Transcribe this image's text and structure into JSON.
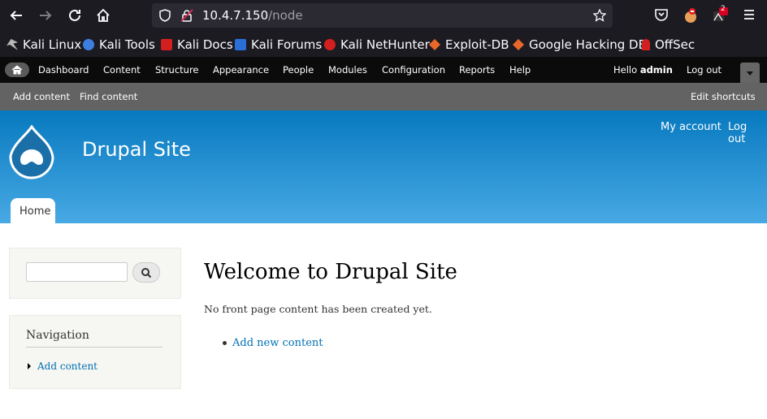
{
  "browser": {
    "url_host": "10.4.7.150",
    "url_path": "/node",
    "notification_count": "2"
  },
  "bookmarks": [
    {
      "label": "Kali Linux",
      "color": "#b8b8b8"
    },
    {
      "label": "Kali Tools",
      "color": "#3d7fe0"
    },
    {
      "label": "Kali Docs",
      "color": "#d21f1f"
    },
    {
      "label": "Kali Forums",
      "color": "#2a6fd8"
    },
    {
      "label": "Kali NetHunter",
      "color": "#d21f1f"
    },
    {
      "label": "Exploit-DB",
      "color": "#e8682a"
    },
    {
      "label": "Google Hacking DB",
      "color": "#e8682a"
    },
    {
      "label": "OffSec",
      "color": "#d21f1f"
    }
  ],
  "toolbar": {
    "menu": [
      "Dashboard",
      "Content",
      "Structure",
      "Appearance",
      "People",
      "Modules",
      "Configuration",
      "Reports",
      "Help"
    ],
    "hello": "Hello ",
    "user": "admin",
    "logout": "Log out"
  },
  "shortcuts": {
    "items": [
      "Add content",
      "Find content"
    ],
    "edit": "Edit shortcuts"
  },
  "header": {
    "site_name": "Drupal Site",
    "my_account": "My account",
    "logout": "Log out",
    "tab_home": "Home"
  },
  "sidebar": {
    "nav_title": "Navigation",
    "nav_items": [
      "Add content"
    ]
  },
  "main": {
    "title": "Welcome to Drupal Site",
    "text": "No front page content has been created yet.",
    "link": "Add new content"
  }
}
